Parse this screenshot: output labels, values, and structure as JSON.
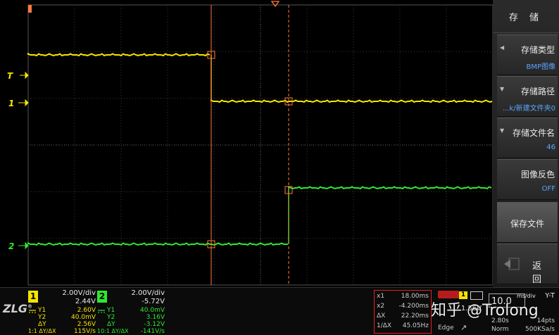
{
  "colors": {
    "ch1": "#f5e400",
    "ch2": "#2ee82e",
    "cursor": "#ff7a3a",
    "grid": "#3a3a3a",
    "menu_value": "#5aa6ff"
  },
  "markers": {
    "trigger": "T",
    "ch1": "1",
    "ch2": "2"
  },
  "menu": {
    "title": "存 储",
    "items": [
      {
        "label": "存储类型",
        "value": "BMP图像",
        "icon": "left-triangle-icon"
      },
      {
        "label": "存储路径",
        "value": "...k/新建文件夹0",
        "icon": "down-triangle-icon"
      },
      {
        "label": "存储文件名",
        "value": "46",
        "icon": "down-triangle-icon"
      },
      {
        "label": "图像反色",
        "value": "OFF"
      },
      {
        "label": "保存文件"
      },
      {
        "label": "返 回",
        "icon": "back-arrow-icon"
      }
    ]
  },
  "status": {
    "logo": "ZLG",
    "ch1": {
      "num": "1",
      "vdiv": "2.00V/div",
      "offset": "2.44V",
      "y1_label": "Y1",
      "y1": "2.60V",
      "y2_label": "Y2",
      "y2": "40.0mV",
      "dy_label": "ΔY",
      "dy": "2.56V",
      "slope_label": "ΔY/ΔX",
      "slope": "115V/s",
      "probe": "1:1"
    },
    "ch2": {
      "num": "2",
      "vdiv": "2.00V/div",
      "offset": "-5.72V",
      "y1_label": "Y1",
      "y1": "40.0mV",
      "y2_label": "Y2",
      "y2": "3.16V",
      "dy_label": "ΔY",
      "dy": "-3.12V",
      "slope_label": "ΔY/ΔX",
      "slope": "-141V/s",
      "probe": "10:1"
    },
    "cursors": [
      {
        "k": "x1",
        "v": "18.00ms"
      },
      {
        "k": "x2",
        "v": "-4.200ms"
      },
      {
        "k": "ΔX",
        "v": "22.20ms"
      },
      {
        "k": "1/ΔX",
        "v": "45.05Hz"
      }
    ],
    "trigger": {
      "source": "1",
      "level": "1.56V",
      "type": "Edge",
      "slope_icon": "rising-edge-icon"
    },
    "timebase": {
      "mode": "Y-T",
      "value": "10.0",
      "unit": "ms/div",
      "delay": "2.80s",
      "points": "14pts",
      "acq": "Norm",
      "rate": "500KSa/s"
    }
  },
  "watermark": "知乎 @Trolong"
}
